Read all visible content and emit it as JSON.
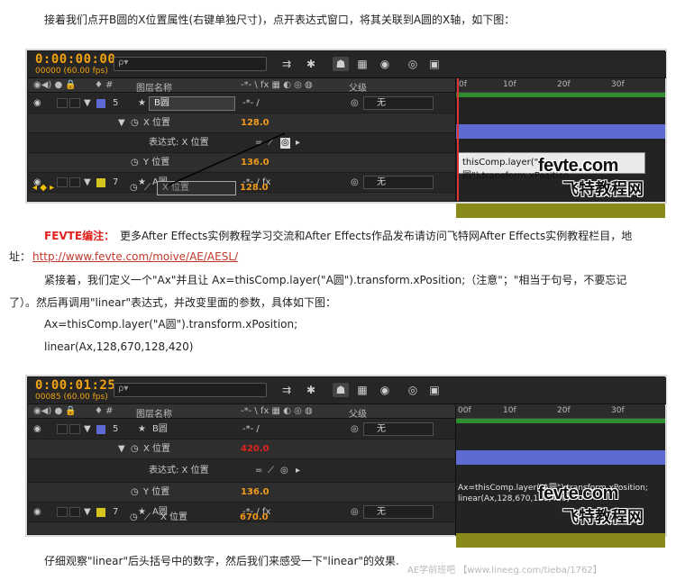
{
  "intro": "接着我们点开B圆的X位置属性(右键单独尺寸)，点开表达式窗口，将其关联到A圆的X轴，如下图：",
  "note_label": "FEVTE编注：",
  "note_text": "更多After Effects实例教程学习交流和After Effects作品发布请访问飞特网After Effects实例教程栏目，地",
  "note_text2": "址：",
  "note_link": "http://www.fevte.com/moive/AE/AESL/",
  "para2_line1": "紧接着，我们定义一个\"Ax\"并且让 Ax=thisComp.layer(\"A圆\").transform.xPosition;（注意\"；\"相当于句号，不要忘记",
  "para2_line2": "了）。然后再调用\"linear\"表达式，并改变里面的参数，具体如下图：",
  "code1": "Ax=thisComp.layer(\"A圆\").transform.xPosition;",
  "code2": "linear(Ax,128,670,128,420)",
  "outro": "仔细观察\"linear\"后头括号中的数字，然后我们来感受一下\"linear\"的效果.",
  "panel1": {
    "timecode": "0:00:00:00",
    "fps": "00000 (60.00 fps)",
    "search_placeholder": "ρ▾",
    "header_layer_name": "图层名称",
    "header_parent": "父级",
    "layer5_num": "5",
    "layer5_name": "B圆",
    "xpos_label": "X 位置",
    "xpos_value": "128.0",
    "expr_label": "表达式: X 位置",
    "ypos_label": "Y 位置",
    "ypos_value": "136.0",
    "layer7_num": "7",
    "layer7_name": "A圆",
    "a_xpos_label": "X 位置",
    "a_xpos_value": "128.0",
    "parent_none": "无",
    "expression": "thisComp.layer(\"A圆\").transform.xPosition",
    "ruler": [
      "0f",
      "10f",
      "20f",
      "30f"
    ]
  },
  "panel2": {
    "timecode": "0:00:01:25",
    "fps": "00085 (60.00 fps)",
    "search_placeholder": "ρ▾",
    "header_layer_name": "图层名称",
    "header_parent": "父级",
    "layer5_num": "5",
    "layer5_name": "B圆",
    "xpos_label": "X 位置",
    "xpos_value": "420.0",
    "expr_label": "表达式: X 位置",
    "ypos_label": "Y 位置",
    "ypos_value": "136.0",
    "layer7_num": "7",
    "layer7_name": "A圆",
    "a_xpos_label": "X 位置",
    "a_xpos_value": "670.0",
    "parent_none": "无",
    "expression_line1": "Ax=thisComp.layer(\"A圆\").transform.xPosition;",
    "expression_line2": "linear(Ax,128,670,128,420)",
    "ruler": [
      "00f",
      "10f",
      "20f",
      "30f"
    ]
  },
  "watermark_domain": "fevte.com",
  "watermark_cn": "飞特教程网",
  "footer_watermark": "AE学前班吧 【www.lineeg.com/tieba/1762】",
  "colors": {
    "timecode": "#f1a310",
    "layer5": "#5e6bd3",
    "layer7": "#d6c51f",
    "accent_red": "#e0231e"
  }
}
